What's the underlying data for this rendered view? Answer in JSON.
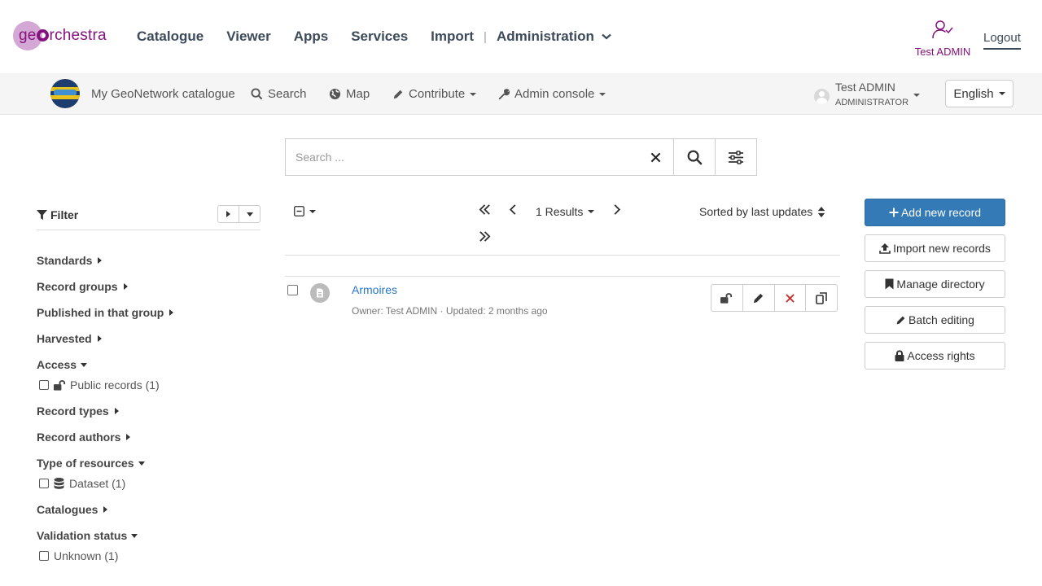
{
  "header": {
    "logo_text_pre": "ge",
    "logo_text_post": "rchestra",
    "nav": [
      "Catalogue",
      "Viewer",
      "Apps",
      "Services",
      "Import"
    ],
    "separator": "|",
    "admin_label": "Administration",
    "user_name": "Test ADMIN",
    "logout_label": "Logout"
  },
  "gn_nav": {
    "catalog_name": "My GeoNetwork catalogue",
    "search": "Search",
    "map": "Map",
    "contribute": "Contribute",
    "admin_console": "Admin console",
    "user_name": "Test ADMIN",
    "user_role": "ADMINISTRATOR",
    "language": "English"
  },
  "search": {
    "placeholder": "Search ..."
  },
  "filter": {
    "title": "Filter",
    "facets": {
      "standards": "Standards",
      "record_groups": "Record groups",
      "published_group": "Published in that group",
      "harvested": "Harvested",
      "access": "Access",
      "access_public": "Public records (1)",
      "record_types": "Record types",
      "record_authors": "Record authors",
      "type_resources": "Type of resources",
      "type_dataset": "Dataset (1)",
      "catalogues": "Catalogues",
      "validation": "Validation status",
      "validation_unknown": "Unknown (1)"
    }
  },
  "results": {
    "count_label": "1 Results",
    "sort_label": "Sorted by last updates",
    "record": {
      "title": "Armoires",
      "owner": "Owner: Test ADMIN",
      "meta_sep": "·",
      "updated": "Updated: 2 months ago"
    }
  },
  "actions": {
    "add_new": "Add new record",
    "import_new": "Import new records",
    "manage_directory": "Manage directory",
    "batch_editing": "Batch editing",
    "access_rights": "Access rights"
  },
  "colors": {
    "brand": "#85127e",
    "primary": "#337ab7",
    "link": "#2a76c8",
    "delete": "#c9302c"
  }
}
